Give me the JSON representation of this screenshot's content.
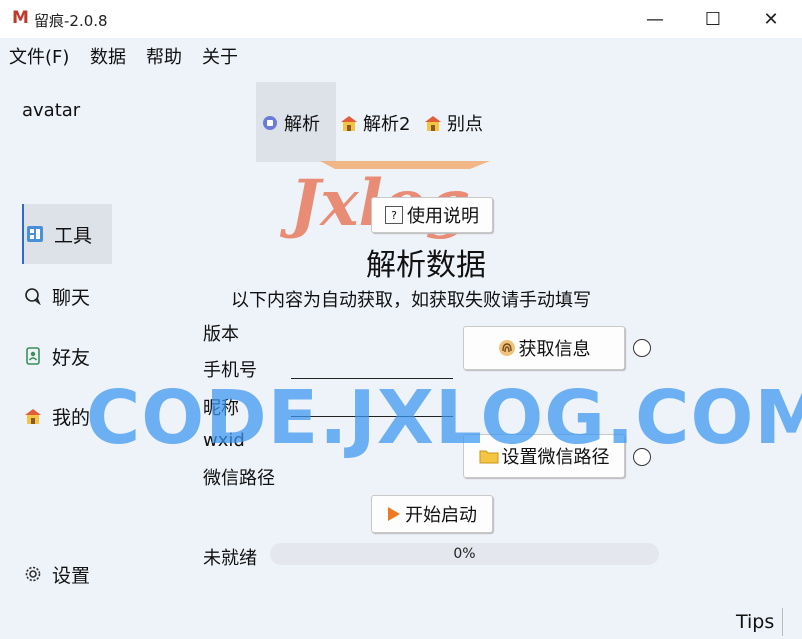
{
  "window": {
    "title": "留痕-2.0.8",
    "logo_letter": "M",
    "minimize": "—",
    "maximize": "☐",
    "close": "✕"
  },
  "menu": [
    "文件(F)",
    "数据",
    "帮助",
    "关于"
  ],
  "sidebar": {
    "avatar_label": "avatar",
    "items": [
      {
        "label": "工具",
        "icon": "tools-icon"
      },
      {
        "label": "聊天",
        "icon": "chat-icon"
      },
      {
        "label": "好友",
        "icon": "contacts-icon"
      },
      {
        "label": "我的",
        "icon": "home-icon"
      },
      {
        "label": "设置",
        "icon": "gear-icon"
      }
    ]
  },
  "tabs": [
    {
      "label": "解析",
      "icon": "parse-icon"
    },
    {
      "label": "解析2",
      "icon": "house-icon"
    },
    {
      "label": "别点",
      "icon": "house-icon"
    }
  ],
  "main": {
    "help_button": "使用说明",
    "heading": "解析数据",
    "subheading": "以下内容为自动获取，如获取失败请手动填写",
    "fields": {
      "version": "版本",
      "phone": "手机号",
      "nickname": "昵称",
      "wxid": "wxid",
      "wechat_path": "微信路径"
    },
    "get_info_button": "获取信息",
    "set_path_button": "设置微信路径",
    "start_button": "开始启动",
    "status": "未就绪",
    "progress_text": "0%",
    "progress_value": 0
  },
  "watermark": {
    "logo_text": "Jxlog",
    "banner": "CODE.JXLOG.COM"
  },
  "footer": {
    "tips": "Tips"
  },
  "colors": {
    "accent": "#2d6cc0",
    "watermark_blue": "#3b97f2",
    "logo_red": "#c0392b"
  }
}
